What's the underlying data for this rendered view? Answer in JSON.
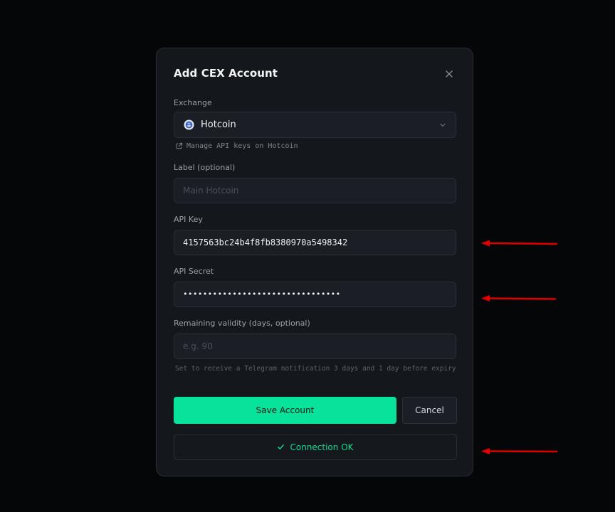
{
  "modal": {
    "title": "Add CEX Account",
    "close_icon": "close-icon"
  },
  "exchange": {
    "label": "Exchange",
    "selected": "Hotcoin",
    "icon": "hotcoin-logo-icon",
    "manage_link": "Manage API keys on Hotcoin",
    "manage_link_icon": "external-link-icon"
  },
  "label_field": {
    "label": "Label (optional)",
    "placeholder": "Main Hotcoin",
    "value": ""
  },
  "api_key": {
    "label": "API Key",
    "value": "4157563bc24b4f8fb8380970a5498342"
  },
  "api_secret": {
    "label": "API Secret",
    "value": "••••••••••••••••••••••••••••••••"
  },
  "validity": {
    "label": "Remaining validity (days, optional)",
    "placeholder": "e.g. 90",
    "hint": "Set to receive a Telegram notification 3 days and 1 day before expiry"
  },
  "actions": {
    "save_label": "Save Account",
    "cancel_label": "Cancel"
  },
  "status": {
    "text": "Connection OK",
    "icon": "check-icon"
  },
  "colors": {
    "accent": "#07e39a",
    "status_ok": "#12d98e",
    "annotation_arrow": "#e00000"
  }
}
